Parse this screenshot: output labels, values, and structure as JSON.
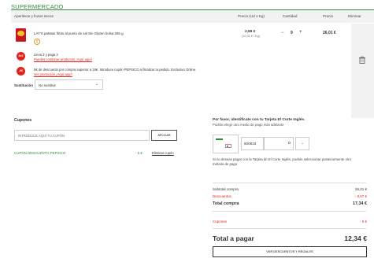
{
  "store": {
    "title": "SUPERMERCADO"
  },
  "cart_header": {
    "category": "Aperitivos y frutos secos",
    "col_price": "Precio (Ud o Kg)",
    "col_quantity": "Cantidad",
    "col_total": "Precio",
    "col_remove": "Eliminar"
  },
  "product": {
    "name": "LAY'S patatas fritas al punto de sal Sin Gluten bolsa 265 g",
    "rating_badge": "2",
    "unit_price": "2,59 €",
    "unit_price_per_kg": "(10,91 € / Kg)",
    "qty_minus": "−",
    "quantity": "9",
    "qty_plus": "+",
    "line_total": "26,01 €",
    "icons": [
      "chips-bag-image",
      "trash-icon"
    ]
  },
  "promotions": [
    {
      "badge": "3x2",
      "line1": "Lleva 3 y paga 2",
      "link": "Puedes combinar productos ¡Aquí aquí!"
    },
    {
      "badge": "-5€",
      "line1": "5€ de descuento por compra superior a 16€. Introduce cupón PEPSICO al finalizar tu pedido. Exclusivo Online.",
      "link": "Ver promoción ¡Aquí aquí!"
    }
  ],
  "substitution": {
    "label": "Sustitución",
    "selected": "No sustituir",
    "chevron": "⌄"
  },
  "coupons": {
    "title": "Cupones",
    "placeholder": "INTRODUCE AQUÍ TU CUPÓN",
    "apply_label": "APLICAR",
    "applied_name": "CUPÓN DESCUENTO PEPSICO",
    "applied_amount": "- 5 €",
    "remove_label": "Eliminar cupón"
  },
  "identify": {
    "title": "Por favor, identifícate con tu Tarjeta El Corte Inglés.",
    "subtitle": "Podrás elegir otro medio de pago más adelante",
    "card_prefix": "600833",
    "card_d": "D",
    "select_chevron": "⌄",
    "note": "Si no deseas pagar con la Tarjeta de El Corte Inglés, podrás seleccionar posteriormente otro método de pago."
  },
  "summary": {
    "subtotal_label": "Subtotal compra",
    "subtotal_value": "26,01 €",
    "discounts_label": "Descuentos",
    "discounts_value": "- 8,67 €",
    "total_label": "Total compra",
    "total_value": "17,34 €",
    "coupons_label": "Cupones",
    "coupons_value": "- 5 €",
    "pay_label": "Total a pagar",
    "pay_value": "12,34 €",
    "details_button": "VER DESCUENTOS Y REGALOS"
  },
  "colors": {
    "brand_green": "#2f8a3b",
    "accent_red": "#e2231a"
  }
}
